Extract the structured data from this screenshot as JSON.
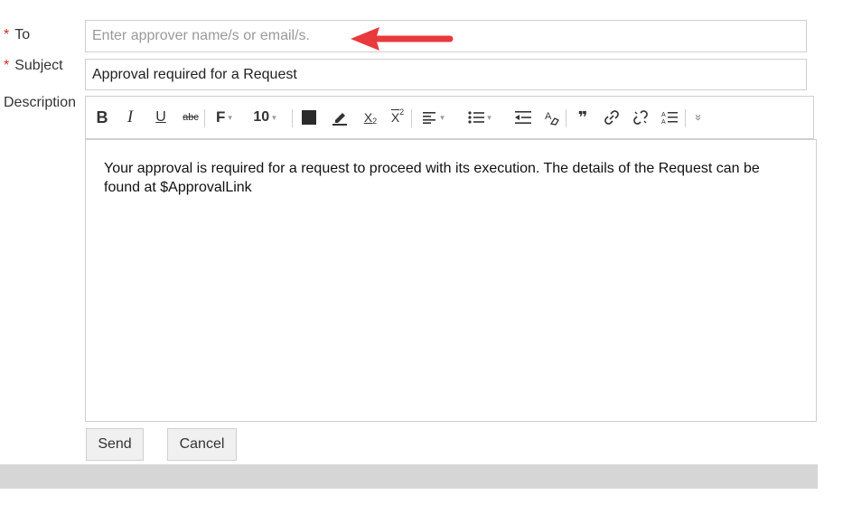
{
  "form": {
    "to": {
      "required_mark": "*",
      "label": "To",
      "value": "",
      "placeholder": "Enter approver name/s or email/s."
    },
    "subject": {
      "required_mark": "*",
      "label": "Subject",
      "value": "Approval required for a Request"
    },
    "description": {
      "label": "Description",
      "body": "Your approval is required for a request to proceed with its execution. The details of the Request can be found at $ApprovalLink"
    }
  },
  "toolbar": {
    "bold": "B",
    "italic": "I",
    "underline": "U",
    "strike": "abc",
    "font_family": "F",
    "font_size": "10",
    "subscript": "X",
    "subscript_mark": "2",
    "superscript": "X",
    "superscript_mark": "2",
    "quote": "❞",
    "more": "»",
    "icons": [
      "bold-icon",
      "italic-icon",
      "underline-icon",
      "strikethrough-icon",
      "font-family-icon",
      "font-size-select",
      "text-color-icon",
      "highlight-color-icon",
      "subscript-icon",
      "superscript-icon",
      "align-icon",
      "bullet-list-icon",
      "outdent-icon",
      "clear-format-icon",
      "quote-icon",
      "link-icon",
      "unlink-icon",
      "line-spacing-icon",
      "more-icon"
    ]
  },
  "actions": {
    "send": "Send",
    "cancel": "Cancel"
  },
  "colors": {
    "required": "#d9261c",
    "arrow": "#e8393c",
    "footer": "#d6d6d6"
  }
}
